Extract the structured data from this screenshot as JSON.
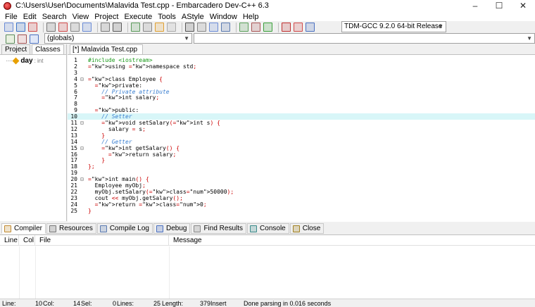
{
  "window": {
    "title": "C:\\Users\\User\\Documents\\Malavida Test.cpp - Embarcadero Dev-C++ 6.3",
    "icon": "devcpp-app-icon",
    "controls": [
      "–",
      "☐",
      "✕"
    ]
  },
  "menu": [
    "File",
    "Edit",
    "Search",
    "View",
    "Project",
    "Execute",
    "Tools",
    "AStyle",
    "Window",
    "Help"
  ],
  "toolbar": {
    "compiler": "TDM-GCC 9.2.0 64-bit Release",
    "scope": "(globals)",
    "button_colors": [
      "#6a8bd6",
      "#3b73c8",
      "#d14a4a",
      "#777777",
      "#d14a4a",
      "#888888",
      "#6a8bd6",
      "#7a7a7a",
      "#5a5a5a",
      "#5a9a5a",
      "#888888",
      "#e0a030",
      "#aaaaaa",
      "#555555",
      "#888888",
      "#6a8bd6",
      "#5a7ab0",
      "#5aa05a",
      "#aa5555",
      "#3ca03c",
      "#c03030",
      "#d14a4a",
      "#4a70c0"
    ]
  },
  "left_panel": {
    "tabs": [
      "Project",
      "Classes"
    ],
    "active_tab": "Classes",
    "items": [
      {
        "name": "day",
        "type": ": int"
      }
    ]
  },
  "editor": {
    "tab_label": "[*] Malavida Test.cpp",
    "current_line": 10,
    "lines": [
      {
        "n": "1",
        "fold": "",
        "code": "#include <iostream>"
      },
      {
        "n": "2",
        "fold": "",
        "code": "using namespace std;"
      },
      {
        "n": "3",
        "fold": "",
        "code": ""
      },
      {
        "n": "4",
        "fold": "⊟",
        "code": "class Employee {"
      },
      {
        "n": "5",
        "fold": "",
        "code": "  private:"
      },
      {
        "n": "6",
        "fold": "",
        "code": "    // Private attribute"
      },
      {
        "n": "7",
        "fold": "",
        "code": "    int salary;"
      },
      {
        "n": "8",
        "fold": "",
        "code": ""
      },
      {
        "n": "9",
        "fold": "",
        "code": "  public:"
      },
      {
        "n": "10",
        "fold": "",
        "code": "    // Setter"
      },
      {
        "n": "11",
        "fold": "⊟",
        "code": "    void setSalary(int s) {"
      },
      {
        "n": "12",
        "fold": "",
        "code": "      salary = s;"
      },
      {
        "n": "13",
        "fold": "",
        "code": "    }"
      },
      {
        "n": "14",
        "fold": "",
        "code": "    // Getter"
      },
      {
        "n": "15",
        "fold": "⊟",
        "code": "    int getSalary() {"
      },
      {
        "n": "16",
        "fold": "",
        "code": "      return salary;"
      },
      {
        "n": "17",
        "fold": "",
        "code": "    }"
      },
      {
        "n": "18",
        "fold": "",
        "code": "};"
      },
      {
        "n": "19",
        "fold": "",
        "code": ""
      },
      {
        "n": "20",
        "fold": "⊟",
        "code": "int main() {"
      },
      {
        "n": "21",
        "fold": "",
        "code": "  Employee myObj;"
      },
      {
        "n": "22",
        "fold": "",
        "code": "  myObj.setSalary(50000);"
      },
      {
        "n": "23",
        "fold": "",
        "code": "  cout << myObj.getSalary();"
      },
      {
        "n": "24",
        "fold": "",
        "code": "  return 0;"
      },
      {
        "n": "25",
        "fold": "",
        "code": "}"
      }
    ]
  },
  "bottom_tabs": [
    {
      "label": "Compiler",
      "icon": "compiler-icon",
      "color": "#c08a30"
    },
    {
      "label": "Resources",
      "icon": "resources-icon",
      "color": "#777777"
    },
    {
      "label": "Compile Log",
      "icon": "compile-log-icon",
      "color": "#5a7ab0"
    },
    {
      "label": "Debug",
      "icon": "debug-icon",
      "color": "#4a70c0"
    },
    {
      "label": "Find Results",
      "icon": "find-results-icon",
      "color": "#888888"
    },
    {
      "label": "Console",
      "icon": "console-icon",
      "color": "#3a8a8a"
    },
    {
      "label": "Close",
      "icon": "close-panel-icon",
      "color": "#a08020"
    }
  ],
  "messages": {
    "columns": [
      "Line",
      "Col",
      "File",
      "Message"
    ]
  },
  "status": {
    "line_label": "Line:",
    "line_value": "10",
    "col_label": "Col:",
    "col_value": "14",
    "sel_label": "Sel:",
    "sel_value": "0",
    "lines_label": "Lines:",
    "lines_value": "25",
    "length_label": "Length:",
    "length_value": "379",
    "mode": "Insert",
    "message": "Done parsing in 0.016 seconds"
  }
}
